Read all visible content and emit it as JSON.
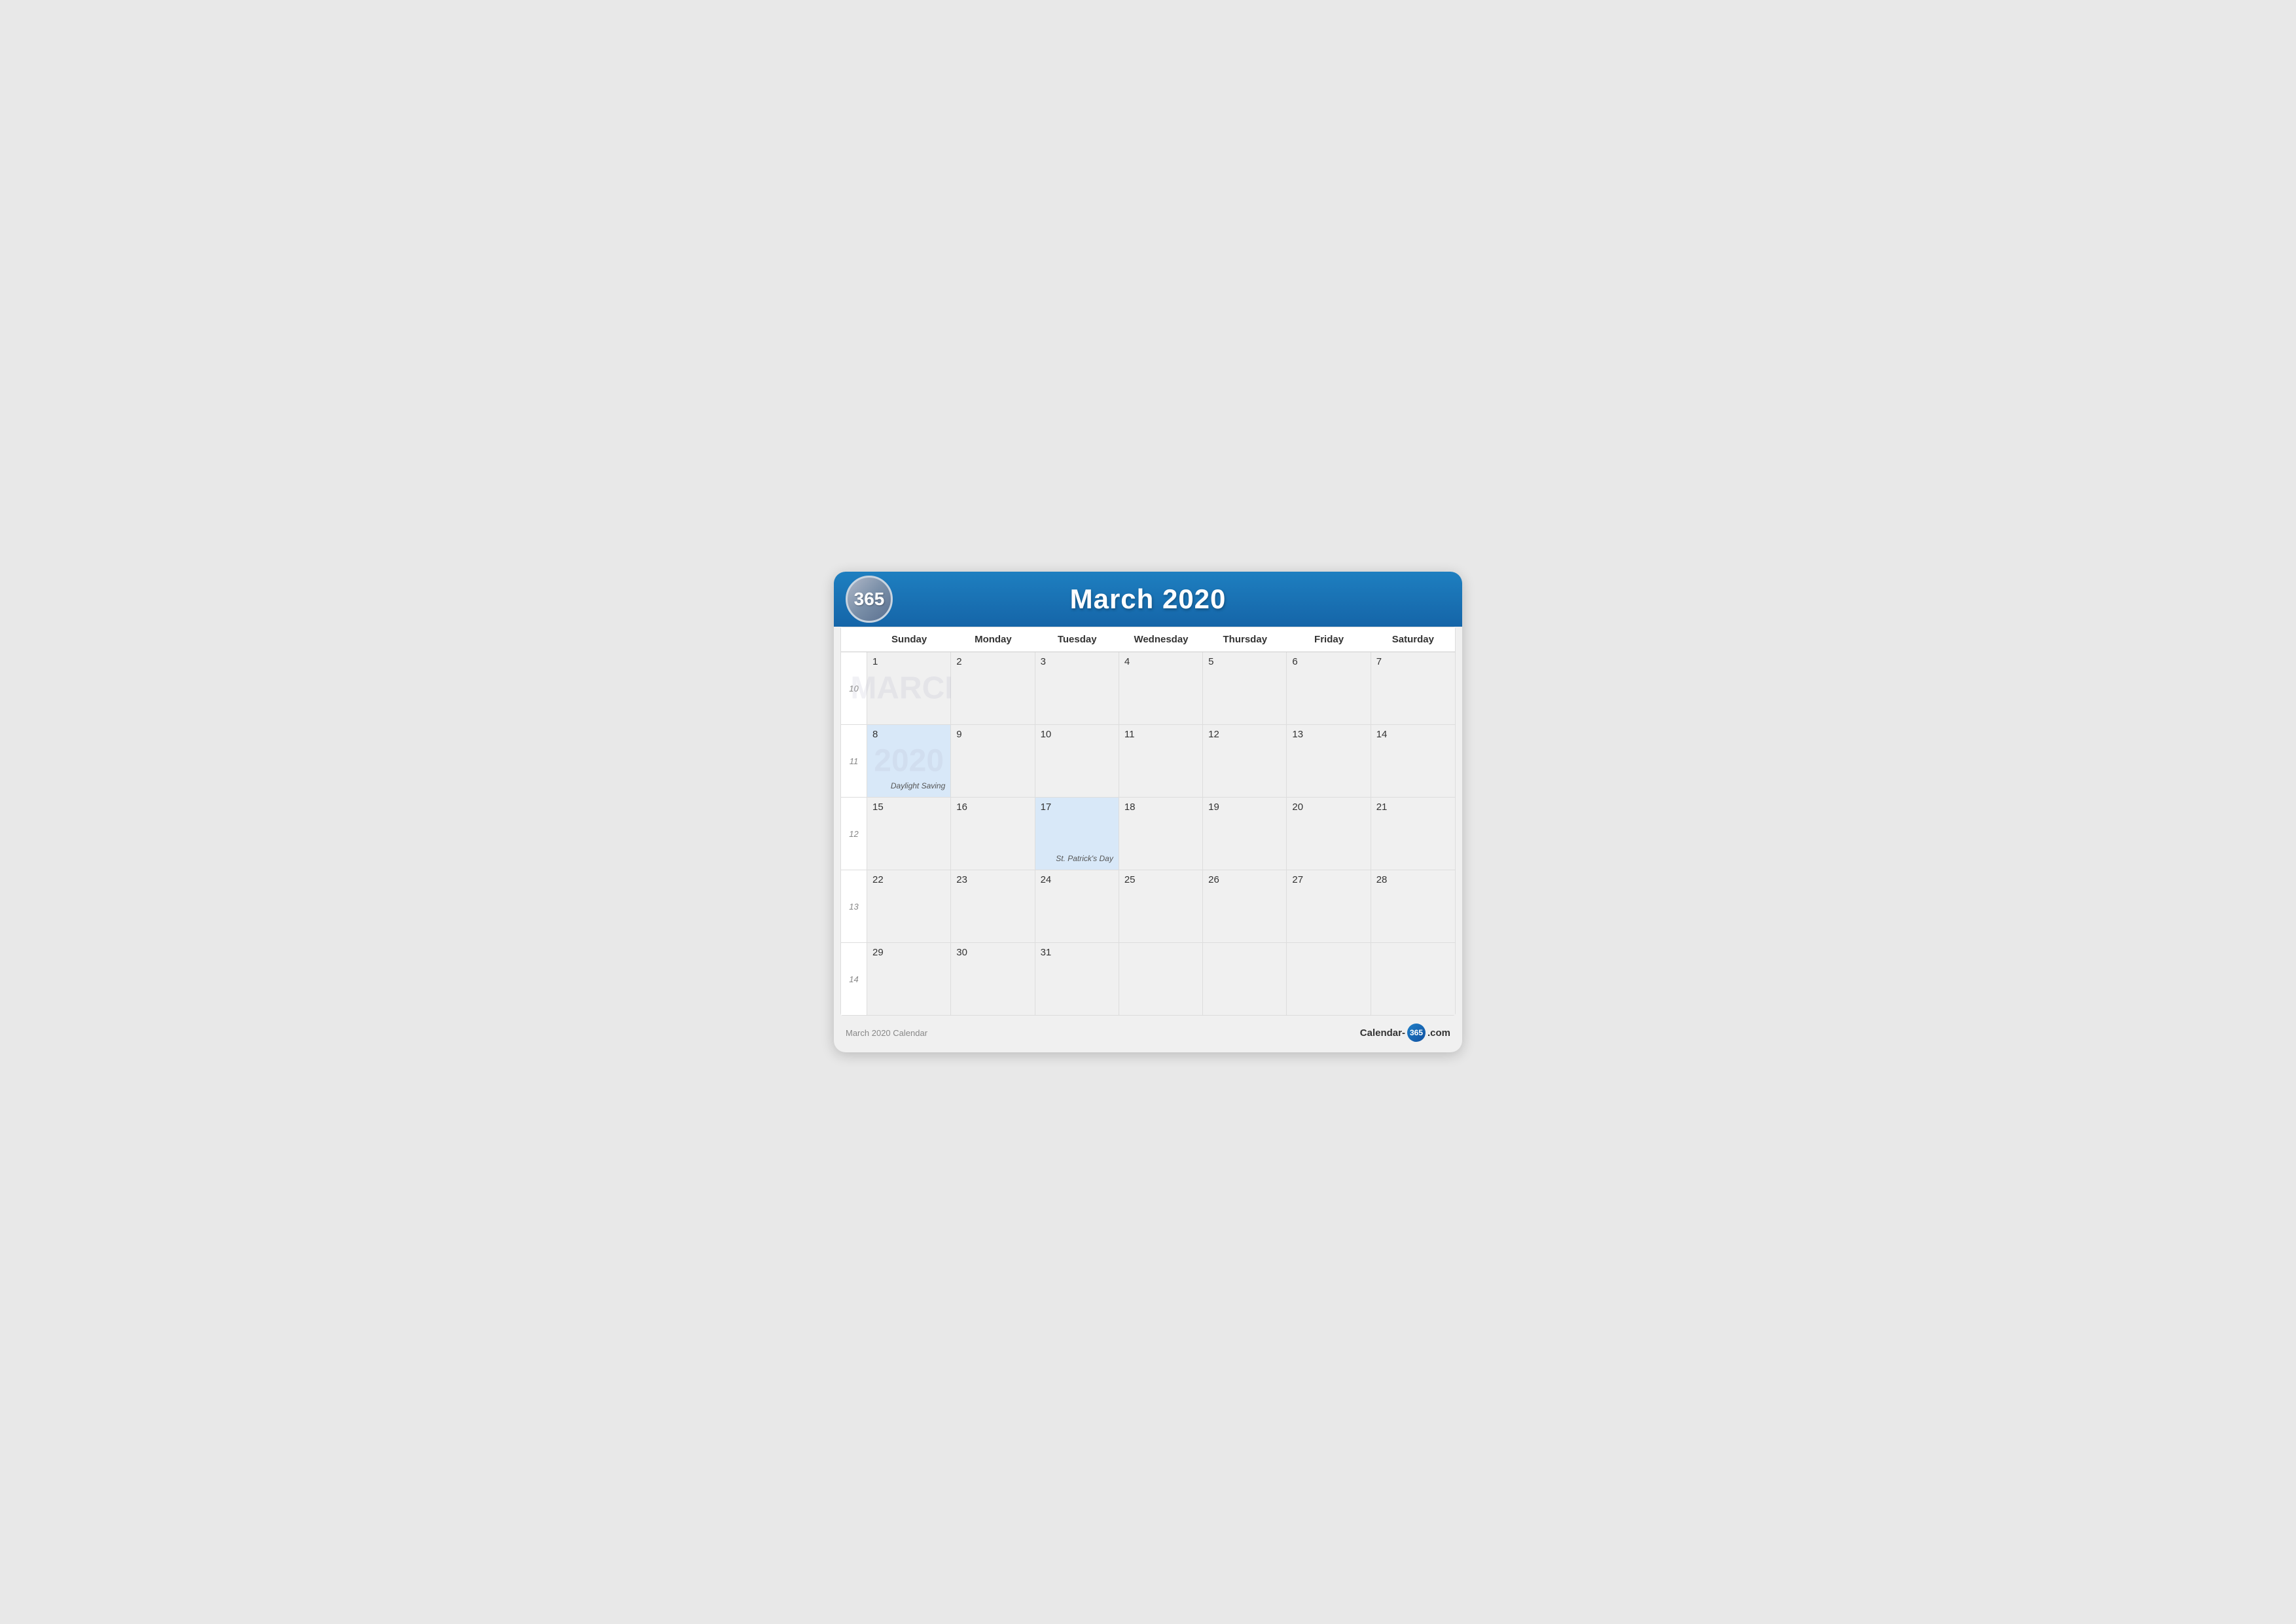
{
  "header": {
    "logo": "365",
    "title": "March 2020"
  },
  "dayHeaders": [
    "Sunday",
    "Monday",
    "Tuesday",
    "Wednesday",
    "Thursday",
    "Friday",
    "Saturday"
  ],
  "weeks": [
    {
      "weekNum": "10",
      "days": [
        {
          "date": "1",
          "empty": false,
          "event": null
        },
        {
          "date": "2",
          "empty": false,
          "event": null
        },
        {
          "date": "3",
          "empty": false,
          "event": null
        },
        {
          "date": "4",
          "empty": false,
          "event": null
        },
        {
          "date": "5",
          "empty": false,
          "event": null
        },
        {
          "date": "6",
          "empty": false,
          "event": null
        },
        {
          "date": "7",
          "empty": false,
          "event": null
        }
      ]
    },
    {
      "weekNum": "11",
      "days": [
        {
          "date": "8",
          "empty": false,
          "event": "Daylight Saving",
          "highlight": true
        },
        {
          "date": "9",
          "empty": false,
          "event": null
        },
        {
          "date": "10",
          "empty": false,
          "event": null
        },
        {
          "date": "11",
          "empty": false,
          "event": null
        },
        {
          "date": "12",
          "empty": false,
          "event": null
        },
        {
          "date": "13",
          "empty": false,
          "event": null
        },
        {
          "date": "14",
          "empty": false,
          "event": null
        }
      ]
    },
    {
      "weekNum": "12",
      "days": [
        {
          "date": "15",
          "empty": false,
          "event": null
        },
        {
          "date": "16",
          "empty": false,
          "event": null
        },
        {
          "date": "17",
          "empty": false,
          "event": "St. Patrick's Day",
          "highlight": true
        },
        {
          "date": "18",
          "empty": false,
          "event": null
        },
        {
          "date": "19",
          "empty": false,
          "event": null
        },
        {
          "date": "20",
          "empty": false,
          "event": null
        },
        {
          "date": "21",
          "empty": false,
          "event": null
        }
      ]
    },
    {
      "weekNum": "13",
      "days": [
        {
          "date": "22",
          "empty": false,
          "event": null
        },
        {
          "date": "23",
          "empty": false,
          "event": null
        },
        {
          "date": "24",
          "empty": false,
          "event": null
        },
        {
          "date": "25",
          "empty": false,
          "event": null
        },
        {
          "date": "26",
          "empty": false,
          "event": null
        },
        {
          "date": "27",
          "empty": false,
          "event": null
        },
        {
          "date": "28",
          "empty": false,
          "event": null
        }
      ]
    },
    {
      "weekNum": "14",
      "days": [
        {
          "date": "29",
          "empty": false,
          "event": null
        },
        {
          "date": "30",
          "empty": false,
          "event": null
        },
        {
          "date": "31",
          "empty": false,
          "event": null
        },
        {
          "date": "",
          "empty": true,
          "event": null
        },
        {
          "date": "",
          "empty": true,
          "event": null
        },
        {
          "date": "",
          "empty": true,
          "event": null
        },
        {
          "date": "",
          "empty": true,
          "event": null
        }
      ]
    }
  ],
  "footer": {
    "left": "March 2020 Calendar",
    "right_prefix": "Calendar-",
    "logo": "365",
    "right_suffix": ".com"
  },
  "watermarks": {
    "week1": "MARCH",
    "week2": "2020"
  }
}
